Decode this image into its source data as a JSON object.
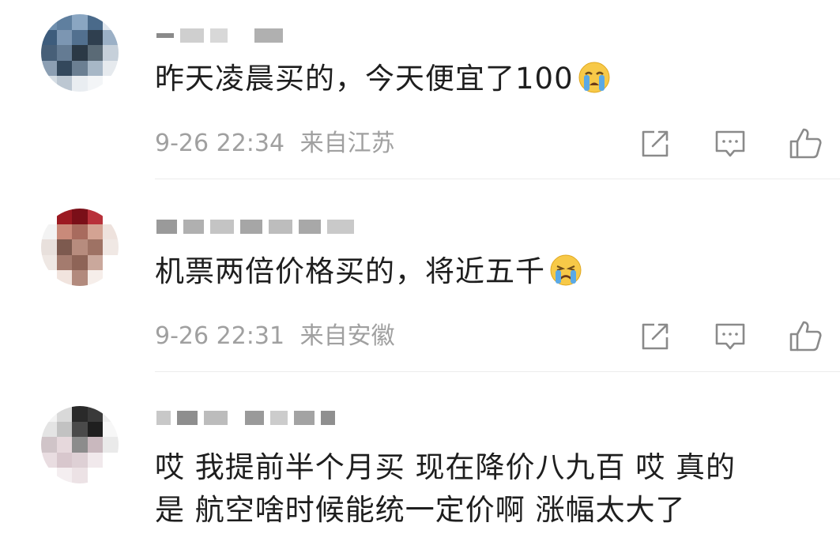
{
  "comments": [
    {
      "text": "昨天凌晨买的，今天便宜了100",
      "emoji": "loudly-crying-emoji",
      "time": "9-26 22:34",
      "location": "来自江苏"
    },
    {
      "text": "机票两倍价格买的，将近五千",
      "emoji": "crying-emoji",
      "time": "9-26 22:31",
      "location": "来自安徽"
    },
    {
      "text_line1": "哎 我提前半个月买 现在降价八九百 哎 真的",
      "text_line2": "是 航空啥时候能统一定价啊 涨幅太大了"
    }
  ],
  "icons": {
    "share": "share-icon",
    "comment": "comment-icon",
    "like": "thumbs-up-icon"
  },
  "colors": {
    "text": "#1e1e1e",
    "meta": "#a0a0a0",
    "icon": "#8a8a8a",
    "emoji_face": "#f7c948",
    "emoji_tears": "#5aa9e6"
  }
}
